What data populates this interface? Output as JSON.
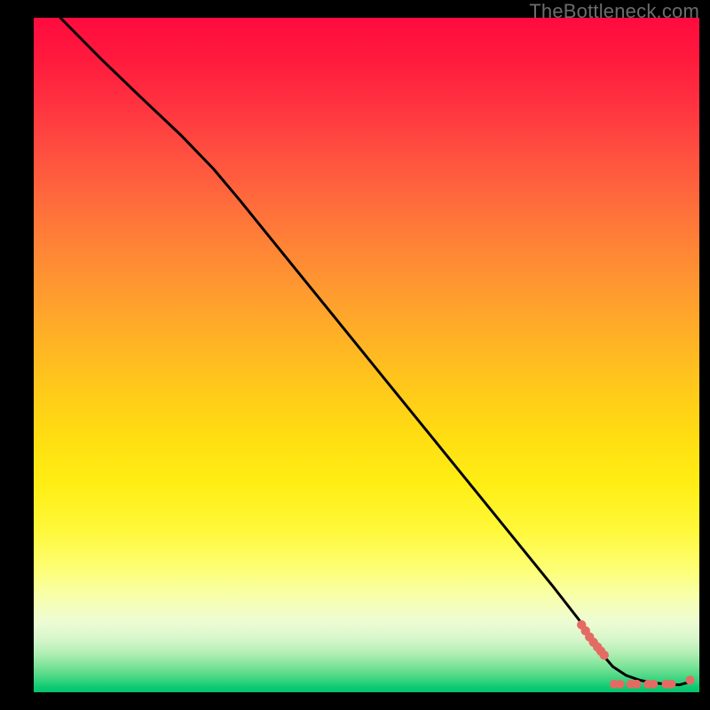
{
  "watermark": "TheBottleneck.com",
  "colors": {
    "curve_stroke": "#000000",
    "dot_fill": "#e46b63",
    "frame_bg": "#000000"
  },
  "chart_data": {
    "type": "line",
    "title": "",
    "xlabel": "",
    "ylabel": "",
    "xlim": [
      0,
      100
    ],
    "ylim": [
      0,
      100
    ],
    "grid": false,
    "note": "Axes have no visible ticks or numeric labels; x/y values are inferred from position within the plot area (0–100 normalized).",
    "series": [
      {
        "name": "curve",
        "style": "line",
        "x": [
          4,
          10,
          16,
          22,
          27,
          31,
          36,
          42,
          48,
          54,
          60,
          66,
          72,
          78,
          82.5,
          85,
          87,
          89,
          91,
          93,
          95,
          97,
          98.5
        ],
        "y": [
          100,
          94,
          88.3,
          82.7,
          77.6,
          72.9,
          66.8,
          59.5,
          52.2,
          44.9,
          37.6,
          30.3,
          23,
          15.7,
          10,
          6.1,
          3.8,
          2.5,
          1.8,
          1.4,
          1.2,
          1.1,
          1.5
        ]
      },
      {
        "name": "dense-dot-cluster",
        "style": "scatter",
        "x": [
          82.3,
          82.9,
          83.5,
          84.1,
          84.7,
          85.2,
          85.7
        ],
        "y": [
          10.0,
          9.1,
          8.2,
          7.4,
          6.7,
          6.1,
          5.5
        ]
      },
      {
        "name": "bottom-dots",
        "style": "scatter",
        "x": [
          87.2,
          88.1,
          89.7,
          90.6,
          92.3,
          93.1,
          95.0,
          95.8,
          98.6
        ],
        "y": [
          1.2,
          1.2,
          1.2,
          1.2,
          1.2,
          1.2,
          1.2,
          1.2,
          1.8
        ]
      }
    ]
  }
}
